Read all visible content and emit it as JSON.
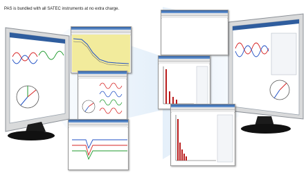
{
  "headline": "PAS is bundled with all SATEC instruments at no extra charge.",
  "colors": {
    "monitor_frame": "#d9dadb",
    "monitor_bezel": "#b9c2cc",
    "monitor_stand": "#111111",
    "screen_blue": "#cfe3f6",
    "title_bar": "#2f5d9e",
    "waveform_red": "#d62020",
    "waveform_blue": "#1f4fc4",
    "waveform_green": "#1f9a2e",
    "spectrum_red": "#b81a1a",
    "trend_yellow": "#f2eb9c"
  },
  "icons": [
    "monitor-icon",
    "pas-window-icon"
  ]
}
